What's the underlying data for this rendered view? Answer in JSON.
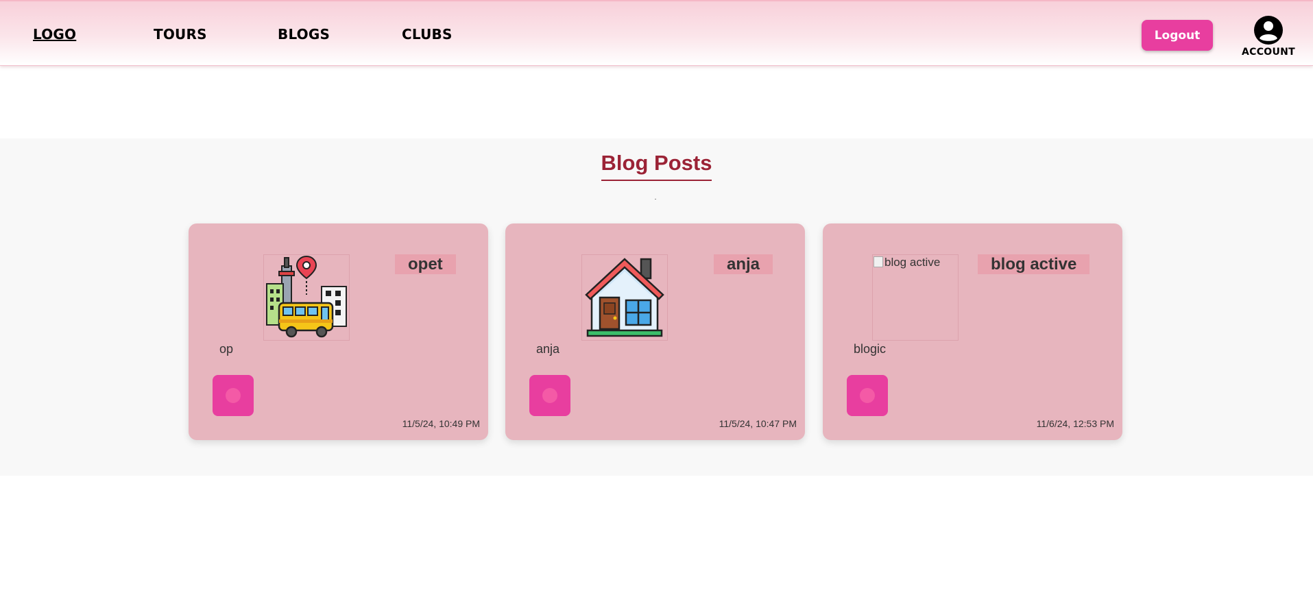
{
  "nav": {
    "logo": "LOGO",
    "links": [
      "TOURS",
      "BLOGS",
      "CLUBS"
    ],
    "logout": "Logout",
    "account": "ACCOUNT"
  },
  "section": {
    "title": "Blog Posts"
  },
  "posts": [
    {
      "title": "opet",
      "description": "op",
      "date": "11/5/24, 10:49 PM",
      "image": "city-bus-icon"
    },
    {
      "title": "anja",
      "description": "anja",
      "date": "11/5/24, 10:47 PM",
      "image": "house-icon"
    },
    {
      "title": "blog active",
      "description": "blogic",
      "date": "11/6/24, 12:53 PM",
      "image_alt": "blog active"
    }
  ],
  "colors": {
    "accent": "#e83e9f",
    "title": "#9b2336",
    "card": "#e7b5be",
    "title_tag": "#e8a2ae"
  }
}
